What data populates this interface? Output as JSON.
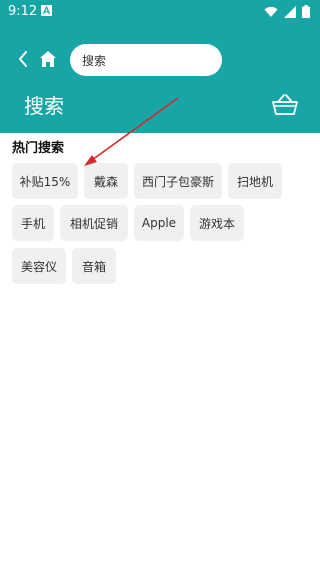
{
  "status_bar": {
    "time": "9:12"
  },
  "header": {
    "search_value": "搜索",
    "title": "搜索"
  },
  "hot_search": {
    "title": "热门搜索",
    "tags": [
      "补贴15%",
      "戴森",
      "西门子包豪斯",
      "扫地机",
      "手机",
      "相机促销",
      "Apple",
      "游戏本",
      "美容仪",
      "音箱"
    ]
  },
  "colors": {
    "header_bg": "#17a5a5",
    "tag_bg": "#f0f0f0",
    "annotation_arrow": "#d22a2a"
  },
  "icons": [
    "back-icon",
    "home-icon",
    "cart-icon",
    "wifi-icon",
    "signal-icon",
    "battery-icon"
  ]
}
